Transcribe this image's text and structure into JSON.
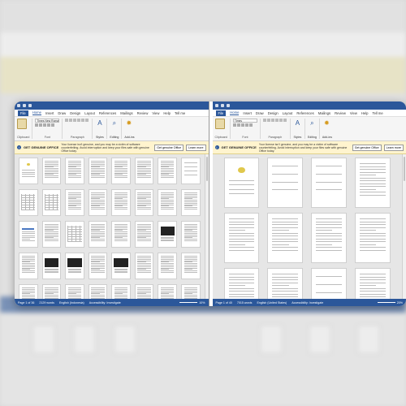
{
  "windows": [
    {
      "tabs": [
        "File",
        "Home",
        "Insert",
        "Draw",
        "Design",
        "Layout",
        "References",
        "Mailings",
        "Review",
        "View",
        "Help",
        "Tell me"
      ],
      "font_name": "Times New Roman",
      "ribbon": {
        "clipboard_label": "Clipboard",
        "font_label": "Font",
        "paragraph_label": "Paragraph",
        "styles_label": "Styles",
        "editing_label": "Editing",
        "addins_label": "Add-ins",
        "paste_label": "Paste"
      },
      "banner": {
        "title": "GET GENUINE OFFICE",
        "message": "Your license isn't genuine, and you may be a victim of software counterfeiting. Avoid interruption and keep your files safe with genuine Office today.",
        "primary_button": "Get genuine Office",
        "secondary_button": "Learn more"
      },
      "status": {
        "page": "Page 1 of 36",
        "words": "2129 words",
        "language": "English (Indonesia)",
        "accessibility": "Accessibility: Investigate",
        "zoom": "10%"
      }
    },
    {
      "tabs": [
        "File",
        "Home",
        "Insert",
        "Draw",
        "Design",
        "Layout",
        "References",
        "Mailings",
        "Review",
        "View",
        "Help",
        "Tell me"
      ],
      "font_name": "Times",
      "ribbon": {
        "clipboard_label": "Clipboard",
        "font_label": "Font",
        "paragraph_label": "Paragraph",
        "styles_label": "Styles",
        "editing_label": "Editing",
        "addins_label": "Add-ins",
        "paste_label": "Paste"
      },
      "banner": {
        "title": "GET GENUINE OFFICE",
        "message": "Your license isn't genuine, and you may be a victim of software counterfeiting. Avoid interruption and keep your files safe with genuine Office today.",
        "primary_button": "Get genuine Office",
        "secondary_button": "Learn more"
      },
      "status": {
        "page": "Page 1 of 40",
        "words": "7015 words",
        "language": "English (United States)",
        "accessibility": "Accessibility: Investigate",
        "zoom": "20%"
      }
    }
  ]
}
